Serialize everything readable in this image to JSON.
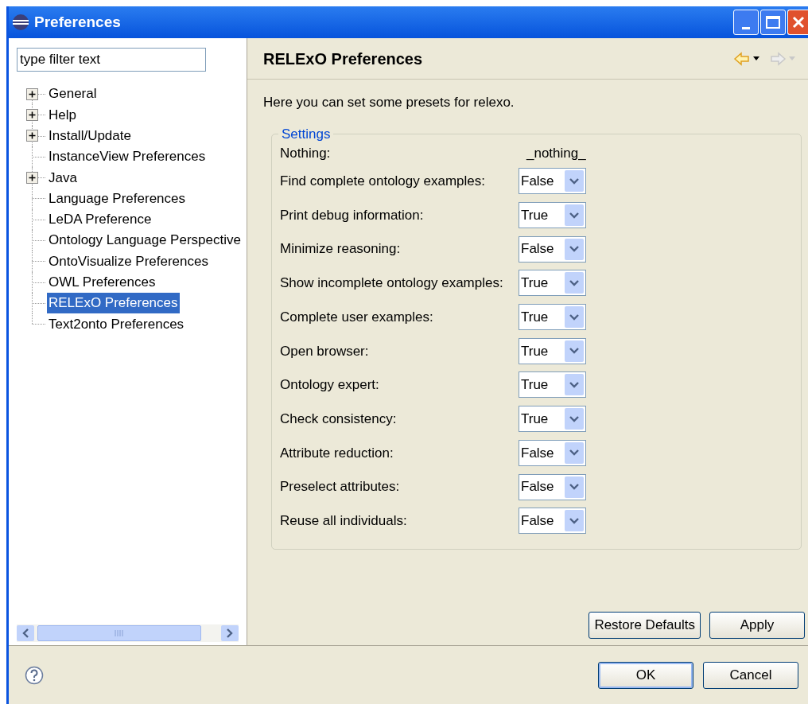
{
  "window": {
    "title": "Preferences"
  },
  "filter": {
    "placeholder": "type filter text"
  },
  "tree": [
    {
      "label": "General",
      "expandable": true,
      "selected": false
    },
    {
      "label": "Help",
      "expandable": true,
      "selected": false
    },
    {
      "label": "Install/Update",
      "expandable": true,
      "selected": false
    },
    {
      "label": "InstanceView Preferences",
      "expandable": false,
      "selected": false
    },
    {
      "label": "Java",
      "expandable": true,
      "selected": false
    },
    {
      "label": "Language Preferences",
      "expandable": false,
      "selected": false
    },
    {
      "label": "LeDA Preference",
      "expandable": false,
      "selected": false
    },
    {
      "label": "Ontology Language Perspective",
      "expandable": false,
      "selected": false
    },
    {
      "label": "OntoVisualize Preferences",
      "expandable": false,
      "selected": false
    },
    {
      "label": "OWL Preferences",
      "expandable": false,
      "selected": false
    },
    {
      "label": "RELExO Preferences",
      "expandable": false,
      "selected": true
    },
    {
      "label": "Text2onto Preferences",
      "expandable": false,
      "selected": false
    }
  ],
  "page": {
    "title": "RELExO Preferences",
    "nav": [
      {
        "kind": "back",
        "disabled": false
      },
      {
        "kind": "forward",
        "disabled": true
      }
    ],
    "description": "Here you can set some presets for relexo."
  },
  "settings": {
    "title": "Settings",
    "rows": [
      {
        "kind": "text",
        "label": "Nothing:",
        "value": "_nothing_"
      },
      {
        "kind": "select",
        "label": "Find complete ontology examples:",
        "value": "False"
      },
      {
        "kind": "select",
        "label": "Print debug information:",
        "value": "True"
      },
      {
        "kind": "select",
        "label": "Minimize reasoning:",
        "value": "False"
      },
      {
        "kind": "select",
        "label": "Show incomplete ontology examples:",
        "value": "True"
      },
      {
        "kind": "select",
        "label": "Complete user examples:",
        "value": "True"
      },
      {
        "kind": "select",
        "label": "Open browser:",
        "value": "True"
      },
      {
        "kind": "select",
        "label": "Ontology expert:",
        "value": "True"
      },
      {
        "kind": "select",
        "label": "Check consistency:",
        "value": "True"
      },
      {
        "kind": "select",
        "label": "Attribute reduction:",
        "value": "False"
      },
      {
        "kind": "select",
        "label": "Preselect attributes:",
        "value": "False"
      },
      {
        "kind": "select",
        "label": "Reuse all individuals:",
        "value": "False"
      }
    ]
  },
  "page_buttons": [
    "Restore Defaults",
    "Apply"
  ],
  "dialog_buttons": [
    {
      "label": "OK",
      "default": true
    },
    {
      "label": "Cancel",
      "default": false
    }
  ]
}
